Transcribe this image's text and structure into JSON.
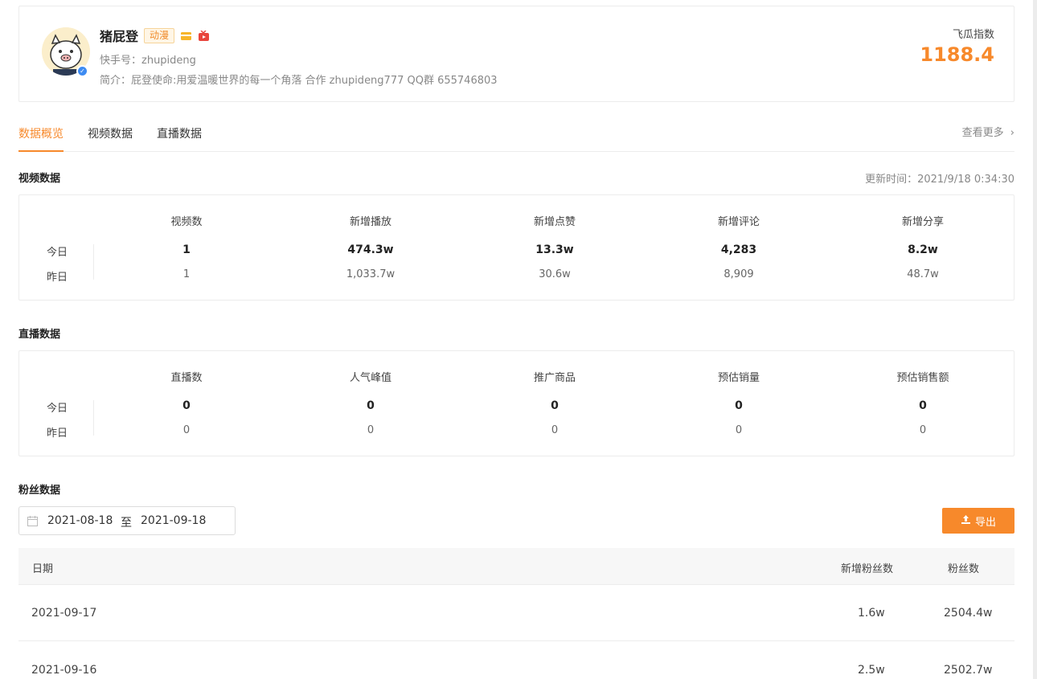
{
  "profile": {
    "name": "猪屁登",
    "tag": "动漫",
    "kuaishou_id": "快手号：zhupideng",
    "bio": "简介：屁登使命:用爱温暖世界的每一个角落 合作 zhupideng777 QQ群 655746803",
    "index_label": "飞瓜指数",
    "index_value": "1188.4",
    "colors": {
      "accent": "#f7892b",
      "verified": "#3d8bf2"
    }
  },
  "tabs": [
    {
      "label": "数据概览",
      "active": true
    },
    {
      "label": "视频数据",
      "active": false
    },
    {
      "label": "直播数据",
      "active": false
    }
  ],
  "view_more": "查看更多",
  "video_section": {
    "title": "视频数据",
    "update_time": "更新时间：2021/9/18 0:34:30",
    "row_labels": {
      "today": "今日",
      "yesterday": "昨日"
    },
    "columns": [
      {
        "header": "视频数",
        "today": "1",
        "yesterday": "1"
      },
      {
        "header": "新增播放",
        "today": "474.3w",
        "yesterday": "1,033.7w"
      },
      {
        "header": "新增点赞",
        "today": "13.3w",
        "yesterday": "30.6w"
      },
      {
        "header": "新增评论",
        "today": "4,283",
        "yesterday": "8,909"
      },
      {
        "header": "新增分享",
        "today": "8.2w",
        "yesterday": "48.7w"
      }
    ]
  },
  "live_section": {
    "title": "直播数据",
    "row_labels": {
      "today": "今日",
      "yesterday": "昨日"
    },
    "columns": [
      {
        "header": "直播数",
        "today": "0",
        "yesterday": "0"
      },
      {
        "header": "人气峰值",
        "today": "0",
        "yesterday": "0"
      },
      {
        "header": "推广商品",
        "today": "0",
        "yesterday": "0"
      },
      {
        "header": "预估销量",
        "today": "0",
        "yesterday": "0"
      },
      {
        "header": "预估销售额",
        "today": "0",
        "yesterday": "0"
      }
    ]
  },
  "fans_section": {
    "title": "粉丝数据",
    "date_start": "2021-08-18",
    "date_sep": "至",
    "date_end": "2021-09-18",
    "export_label": "导出",
    "headers": {
      "date": "日期",
      "new_fans": "新增粉丝数",
      "fans": "粉丝数"
    },
    "rows": [
      {
        "date": "2021-09-17",
        "new_fans": "1.6w",
        "fans": "2504.4w"
      },
      {
        "date": "2021-09-16",
        "new_fans": "2.5w",
        "fans": "2502.7w"
      }
    ]
  }
}
